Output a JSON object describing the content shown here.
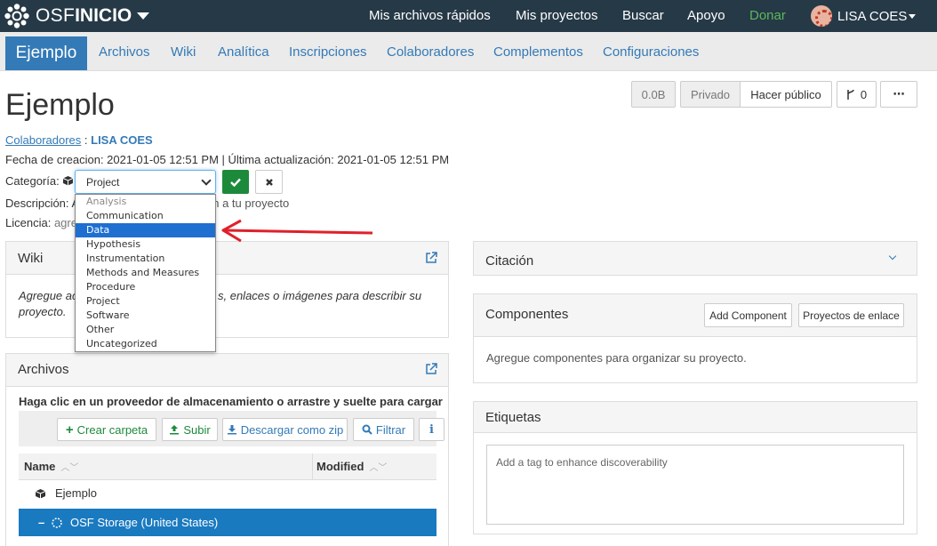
{
  "topnav": {
    "brand_osf": "OSF",
    "brand_inicio": "INICIO",
    "quick_files": "Mis archivos rápidos",
    "my_projects": "Mis proyectos",
    "search": "Buscar",
    "support": "Apoyo",
    "donate": "Donar",
    "user": "LISA COES",
    "donate_color": "#5cb85c"
  },
  "projnav": {
    "title": "Ejemplo",
    "tabs": [
      "Archivos",
      "Wiki",
      "Analítica",
      "Inscripciones",
      "Colaboradores",
      "Complementos",
      "Configuraciones"
    ]
  },
  "header": {
    "title": "Ejemplo",
    "size": "0.0B",
    "privacy": "Privado",
    "make_public": "Hacer público",
    "forks_count": "0",
    "more": "⋯"
  },
  "meta": {
    "contributors_label": "Colaboradores",
    "contributors_sep": " : ",
    "contributor": "LISA COES",
    "dates": "Fecha de creacion: 2021-01-05 12:51 PM | Última actualización: 2021-01-05 12:51 PM",
    "category_label": "Categoría:",
    "description_label": "Descripción:",
    "description_visible": "ón a tu proyecto",
    "description_partial": "A",
    "license_label": "Licencia:",
    "license_partial": "agre"
  },
  "category": {
    "selected": "Project",
    "options": [
      {
        "label": "Analysis",
        "state": "disabled"
      },
      {
        "label": "Communication",
        "state": "normal"
      },
      {
        "label": "Data",
        "state": "highlighted"
      },
      {
        "label": "Hypothesis",
        "state": "normal"
      },
      {
        "label": "Instrumentation",
        "state": "normal"
      },
      {
        "label": "Methods and Measures",
        "state": "normal"
      },
      {
        "label": "Procedure",
        "state": "normal"
      },
      {
        "label": "Project",
        "state": "normal"
      },
      {
        "label": "Software",
        "state": "normal"
      },
      {
        "label": "Other",
        "state": "normal"
      },
      {
        "label": "Uncategorized",
        "state": "normal"
      }
    ]
  },
  "wiki": {
    "title": "Wiki",
    "body_line1_left": "Agregue ac",
    "body_line1_right": "s, enlaces o imágenes para describir su",
    "body_line2": "proyecto."
  },
  "files": {
    "title": "Archivos",
    "hint": "Haga clic en un proveedor de almacenamiento o arrastre y suelte para cargar",
    "toolbar": {
      "new_folder": "Crear carpeta",
      "upload": "Subir",
      "download_zip": "Descargar como zip",
      "filter": "Filtrar",
      "info": "i"
    },
    "columns": {
      "name": "Name",
      "modified": "Modified"
    },
    "rows": {
      "project": "Ejemplo",
      "storage": "OSF Storage (United States)"
    }
  },
  "citation": {
    "title": "Citación"
  },
  "components": {
    "title": "Componentes",
    "add_component": "Add Component",
    "link_projects": "Proyectos de enlace",
    "body": "Agregue componentes para organizar su proyecto."
  },
  "tags": {
    "title": "Etiquetas",
    "placeholder": "Add a tag to enhance discoverability"
  },
  "colors": {
    "navbar": "#263947",
    "accent": "#337ab7",
    "success": "#1d8a3b",
    "selected_row": "#1a7ac0",
    "annotation_arrow": "#e0202a"
  }
}
